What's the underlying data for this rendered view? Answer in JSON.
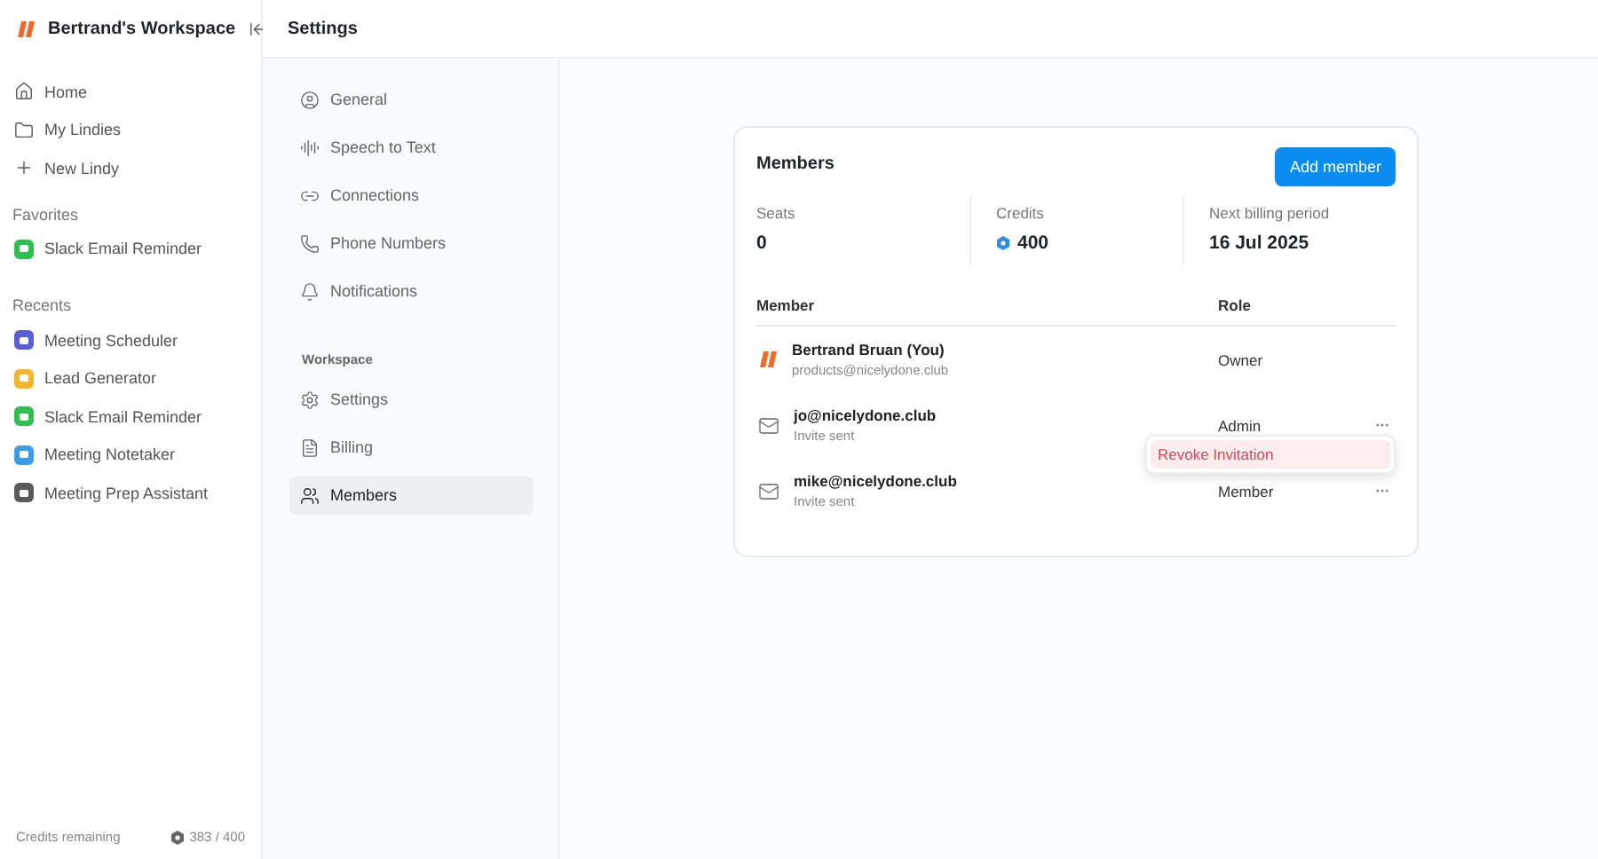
{
  "workspace": {
    "name": "Bertrand's Workspace"
  },
  "sidebar": {
    "items": [
      {
        "kind": "home",
        "label": "Home"
      },
      {
        "kind": "folder",
        "label": "My Lindies"
      },
      {
        "kind": "plus",
        "label": "New Lindy"
      }
    ],
    "favorites": {
      "title": "Favorites",
      "items": [
        {
          "label": "Slack Email Reminder",
          "color": "#2fbf4f"
        }
      ]
    },
    "recents": {
      "title": "Recents",
      "items": [
        {
          "label": "Meeting Scheduler",
          "color": "#5b5fd6"
        },
        {
          "label": "Lead Generator",
          "color": "#f2b52c"
        },
        {
          "label": "Slack Email Reminder",
          "color": "#2fbf4f"
        },
        {
          "label": "Meeting Notetaker",
          "color": "#3b9de6"
        },
        {
          "label": "Meeting Prep Assistant",
          "color": "#5a5a5a"
        }
      ]
    },
    "credits": {
      "label": "Credits remaining",
      "value": "383 / 400"
    }
  },
  "header": {
    "title": "Settings"
  },
  "settings_nav": {
    "items": [
      {
        "kind": "user",
        "label": "General",
        "selected": false
      },
      {
        "kind": "audio",
        "label": "Speech to Text",
        "selected": false
      },
      {
        "kind": "link",
        "label": "Connections",
        "selected": false
      },
      {
        "kind": "phone",
        "label": "Phone Numbers",
        "selected": false
      },
      {
        "kind": "bell",
        "label": "Notifications",
        "selected": false
      }
    ],
    "section": "Workspace",
    "workspace_items": [
      {
        "kind": "gear",
        "label": "Settings",
        "selected": false
      },
      {
        "kind": "file",
        "label": "Billing",
        "selected": false
      },
      {
        "kind": "users",
        "label": "Members",
        "selected": true
      }
    ]
  },
  "members": {
    "title": "Members",
    "add_button": "Add member",
    "stats": [
      {
        "label": "Seats",
        "value": "0",
        "kind": "plain"
      },
      {
        "label": "Credits",
        "value": "400",
        "kind": "credits"
      },
      {
        "label": "Next billing period",
        "value": "16 Jul 2025",
        "kind": "plain"
      }
    ],
    "columns": [
      "Member",
      "Role"
    ],
    "rows": [
      {
        "kind": "owner",
        "name": "Bertrand Bruan (You)",
        "detail": "products@nicelydone.club",
        "role": "Owner",
        "menu": false
      },
      {
        "kind": "invite",
        "name": "jo@nicelydone.club",
        "detail": "Invite sent",
        "role": "Admin",
        "menu": true,
        "menu_open": true
      },
      {
        "kind": "invite",
        "name": "mike@nicelydone.club",
        "detail": "Invite sent",
        "role": "Member",
        "menu": true
      }
    ],
    "popup_item": "Revoke Invitation"
  }
}
